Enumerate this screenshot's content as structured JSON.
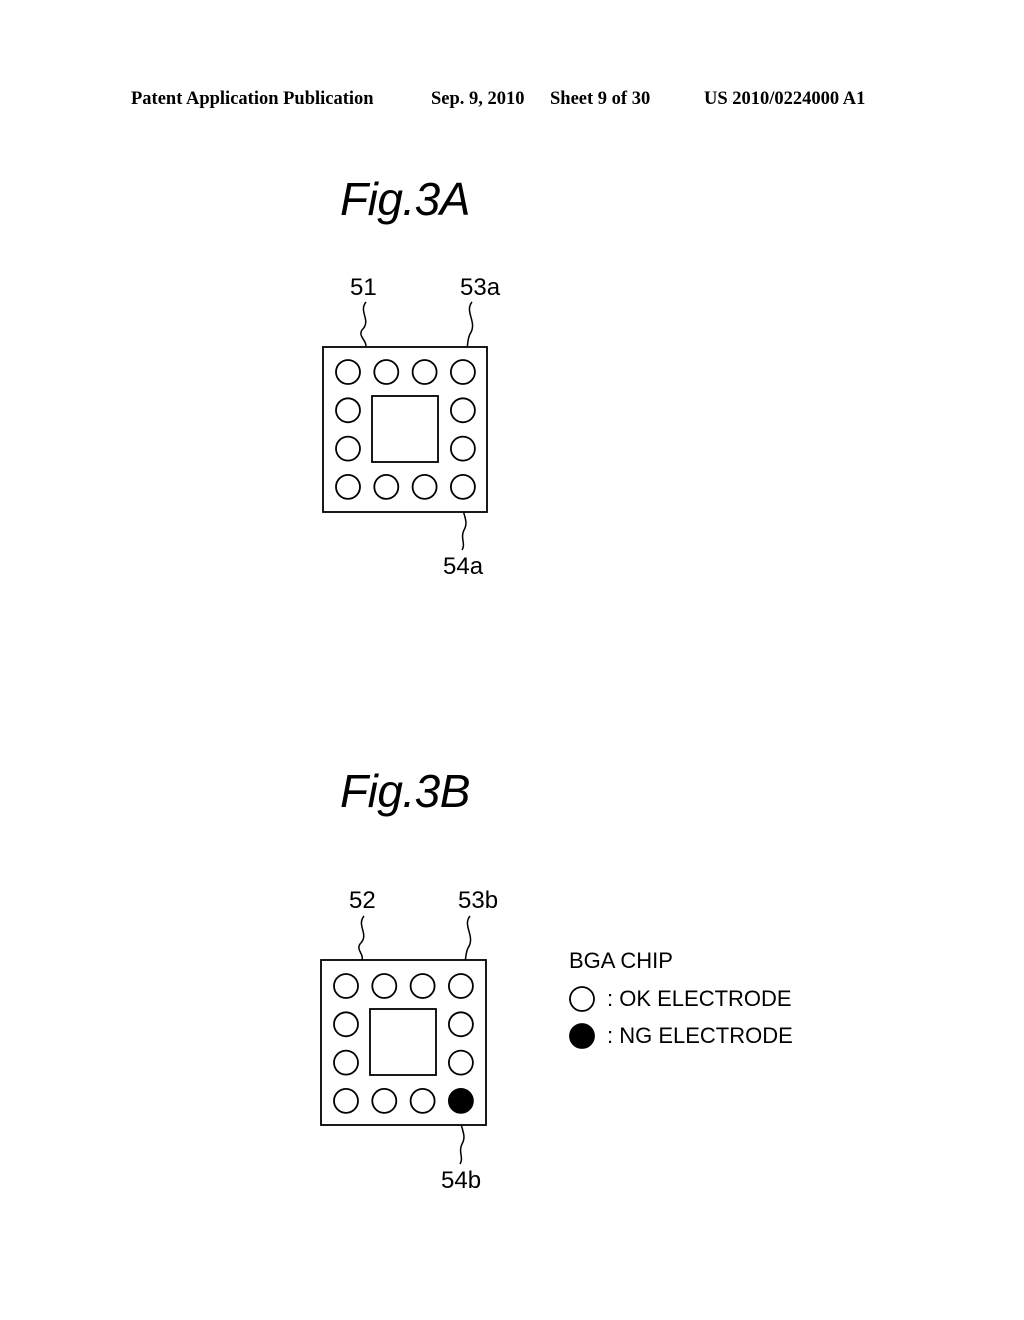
{
  "header": {
    "publication": "Patent Application Publication",
    "date": "Sep. 9, 2010",
    "sheet": "Sheet 9 of 30",
    "patent_number": "US 2010/0224000 A1"
  },
  "figures": [
    {
      "title": "Fig.3A",
      "chip_ref": "51",
      "top_electrode_ref": "53a",
      "bottom_electrode_ref": "54a",
      "electrodes": [
        [
          "ok",
          "ok",
          "ok",
          "ok"
        ],
        [
          "ok",
          "",
          "",
          "ok"
        ],
        [
          "ok",
          "",
          "",
          "ok"
        ],
        [
          "ok",
          "ok",
          "ok",
          "ok"
        ]
      ]
    },
    {
      "title": "Fig.3B",
      "chip_ref": "52",
      "top_electrode_ref": "53b",
      "bottom_electrode_ref": "54b",
      "electrodes": [
        [
          "ok",
          "ok",
          "ok",
          "ok"
        ],
        [
          "ok",
          "",
          "",
          "ok"
        ],
        [
          "ok",
          "",
          "",
          "ok"
        ],
        [
          "ok",
          "ok",
          "ok",
          "ng"
        ]
      ]
    }
  ],
  "legend": {
    "title": "BGA CHIP",
    "ok_label": ": OK ELECTRODE",
    "ng_label": ": NG ELECTRODE"
  }
}
